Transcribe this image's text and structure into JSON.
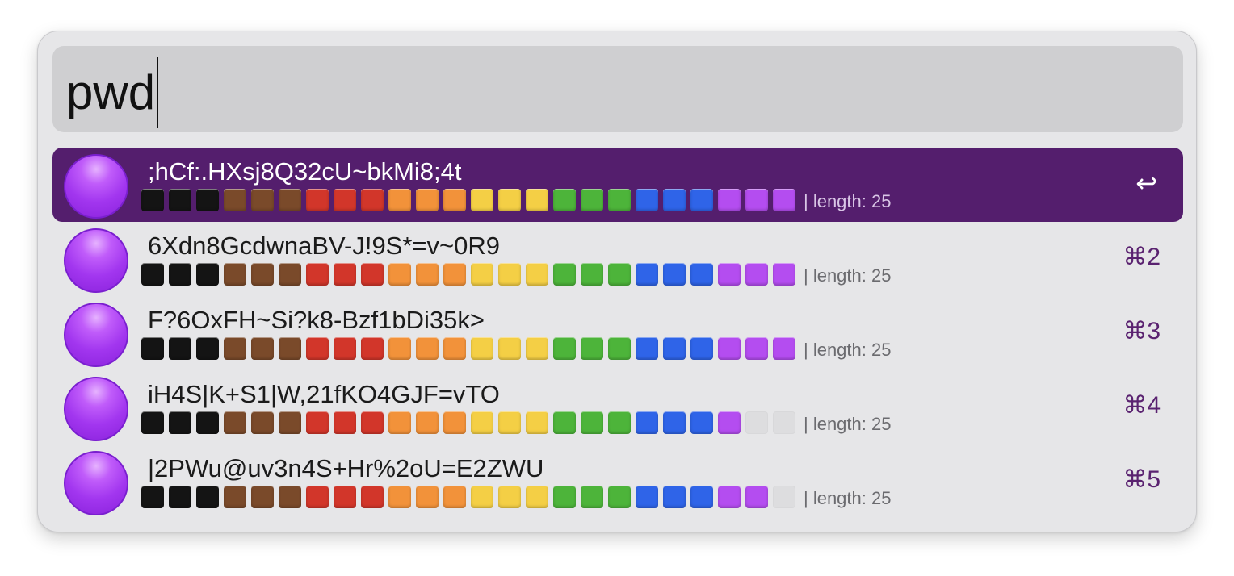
{
  "search": {
    "query": "pwd"
  },
  "results": [
    {
      "password": ";hCf:.HXsj8Q32cU~bkMi8;4t",
      "length_label": "| length: 25",
      "shortcut": "↩",
      "selected": true,
      "strength_filled": 24
    },
    {
      "password": "6Xdn8GcdwnaBV-J!9S*=v~0R9",
      "length_label": "| length: 25",
      "shortcut": "⌘2",
      "selected": false,
      "strength_filled": 24
    },
    {
      "password": "F?6OxFH~Si?k8-Bzf1bDi35k>",
      "length_label": "| length: 25",
      "shortcut": "⌘3",
      "selected": false,
      "strength_filled": 24
    },
    {
      "password": "iH4S|K+S1|W,21fKO4GJF=vTO",
      "length_label": "| length: 25",
      "shortcut": "⌘4",
      "selected": false,
      "strength_filled": 22
    },
    {
      "password": "|2PWu@uv3n4S+Hr%2oU=E2ZWU",
      "length_label": "| length: 25",
      "shortcut": "⌘5",
      "selected": false,
      "strength_filled": 23
    }
  ],
  "strength_meter": {
    "total_squares": 24,
    "colors": [
      "#141414",
      "#141414",
      "#141414",
      "#7a4a2a",
      "#7a4a2a",
      "#7a4a2a",
      "#d2362a",
      "#d2362a",
      "#d2362a",
      "#f2923a",
      "#f2923a",
      "#f2923a",
      "#f4cf45",
      "#f4cf45",
      "#f4cf45",
      "#4db43a",
      "#4db43a",
      "#4db43a",
      "#2f64e8",
      "#2f64e8",
      "#2f64e8",
      "#b44df0",
      "#b44df0",
      "#b44df0"
    ],
    "empty_color": "#dddddf"
  },
  "colors": {
    "selected_row": "#541e6d",
    "accent_purple": "#a236ef"
  }
}
